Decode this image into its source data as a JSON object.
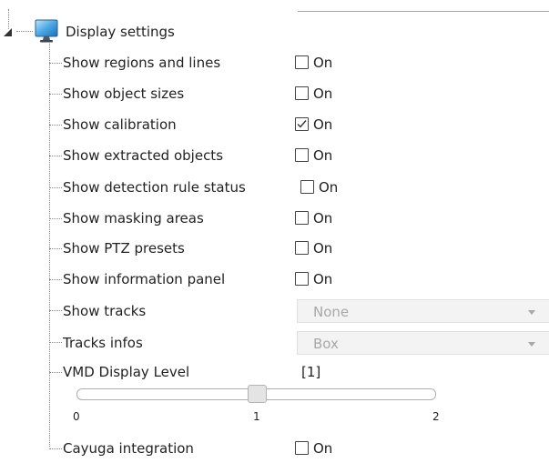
{
  "section": {
    "title": "Display settings",
    "icon": "monitor-icon",
    "expander_icon": "collapse-triangle-icon"
  },
  "checkbox_rows": [
    {
      "label": "Show regions and lines",
      "checked": false,
      "option": "On"
    },
    {
      "label": "Show object sizes",
      "checked": false,
      "option": "On"
    },
    {
      "label": "Show calibration",
      "checked": true,
      "option": "On"
    },
    {
      "label": "Show extracted objects",
      "checked": false,
      "option": "On"
    },
    {
      "label": "Show detection rule status",
      "checked": false,
      "option": "On"
    },
    {
      "label": "Show masking areas",
      "checked": false,
      "option": "On"
    },
    {
      "label": "Show PTZ presets",
      "checked": false,
      "option": "On"
    },
    {
      "label": "Show information panel",
      "checked": false,
      "option": "On"
    }
  ],
  "select_rows": [
    {
      "label": "Show tracks",
      "value": "None"
    },
    {
      "label": "Tracks infos",
      "value": "Box"
    }
  ],
  "vmd": {
    "label": "VMD Display Level",
    "value_display": "[1]",
    "value": 1,
    "min": 0,
    "max": 2,
    "ticks": [
      "0",
      "1",
      "2"
    ]
  },
  "cayuga": {
    "label": "Cayuga integration",
    "checked": false,
    "option": "On"
  },
  "colors": {
    "text": "#222222",
    "select_text": "#a8a8a8",
    "select_bg": "#f3f3f3",
    "tree_line": "#8a8a8a"
  }
}
